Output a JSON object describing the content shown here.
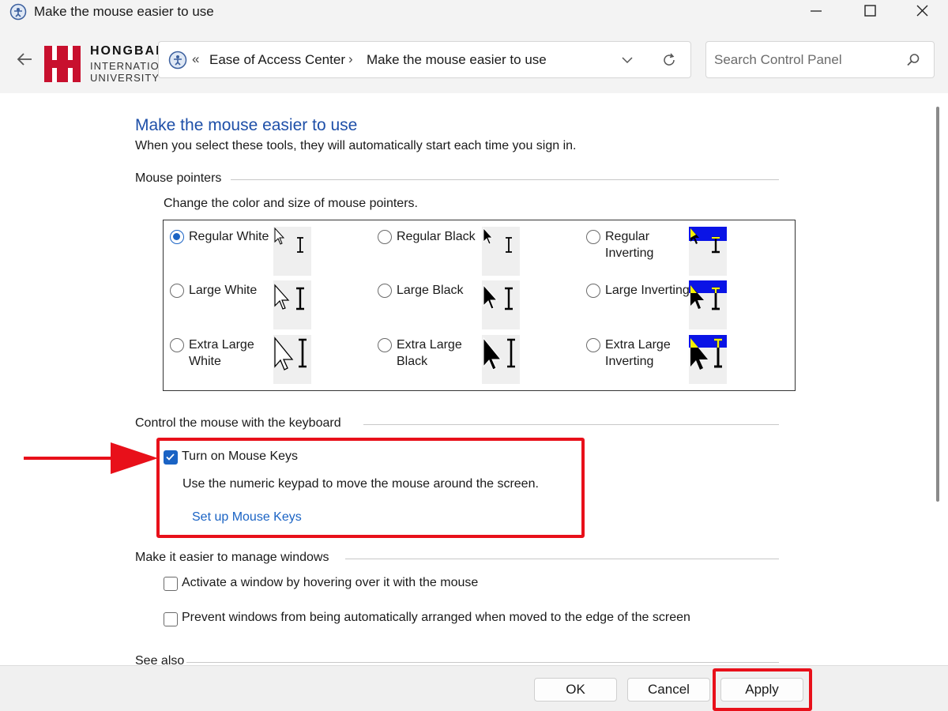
{
  "window": {
    "title": "Make the mouse easier to use"
  },
  "logo": {
    "name": "HONGBANG",
    "line2": "INTERNATIONAL",
    "line3": "UNIVERSITY"
  },
  "address_bar": {
    "prefix": "«",
    "breadcrumbs": [
      "Ease of Access Center",
      "Make the mouse easier to use"
    ],
    "separator": "›"
  },
  "search": {
    "placeholder": "Search Control Panel"
  },
  "main": {
    "heading": "Make the mouse easier to use",
    "subheading": "When you select these tools, they will automatically start each time you sign in.",
    "mouse_pointers": {
      "section_title": "Mouse pointers",
      "description": "Change the color and size of mouse pointers.",
      "options": [
        {
          "label": "Regular White",
          "checked": true
        },
        {
          "label": "Regular Black",
          "checked": false
        },
        {
          "label": "Regular Inverting",
          "checked": false
        },
        {
          "label": "Large White",
          "checked": false
        },
        {
          "label": "Large Black",
          "checked": false
        },
        {
          "label": "Large Inverting",
          "checked": false
        },
        {
          "label": "Extra Large White",
          "checked": false
        },
        {
          "label": "Extra Large Black",
          "checked": false
        },
        {
          "label": "Extra Large Inverting",
          "checked": false
        }
      ]
    },
    "keyboard": {
      "section_title": "Control the mouse with the keyboard",
      "mouse_keys_label": "Turn on Mouse Keys",
      "mouse_keys_checked": true,
      "mouse_keys_description": "Use the numeric keypad to move the mouse around the screen.",
      "setup_link": "Set up Mouse Keys"
    },
    "windows": {
      "section_title": "Make it easier to manage windows",
      "hover_activate_label": "Activate a window by hovering over it with the mouse",
      "hover_activate_checked": false,
      "prevent_arrange_label": "Prevent windows from being automatically arranged when moved to the edge of the screen",
      "prevent_arrange_checked": false
    },
    "see_also": {
      "section_title": "See also"
    }
  },
  "footer": {
    "ok_label": "OK",
    "cancel_label": "Cancel",
    "apply_label": "Apply"
  },
  "colors": {
    "accent": "#1a63c4",
    "heading": "#1e4fa8",
    "annotation": "#e8101a",
    "logo_red": "#c8102e"
  }
}
